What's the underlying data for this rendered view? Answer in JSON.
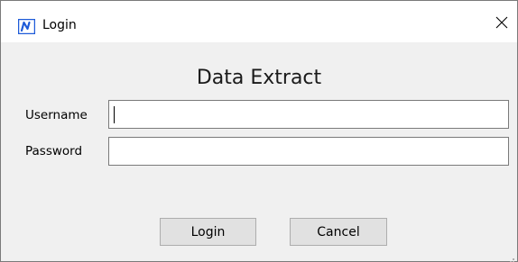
{
  "window": {
    "title": "Login",
    "icon": "app-logo-icon",
    "close_icon": "close-icon"
  },
  "form": {
    "heading": "Data Extract",
    "username_label": "Username",
    "username_value": "",
    "password_label": "Password",
    "password_value": ""
  },
  "buttons": {
    "login_label": "Login",
    "cancel_label": "Cancel"
  },
  "colors": {
    "accent": "#1e5bd8",
    "button_bg": "#e1e1e1",
    "window_bg": "#f0f0f0"
  }
}
